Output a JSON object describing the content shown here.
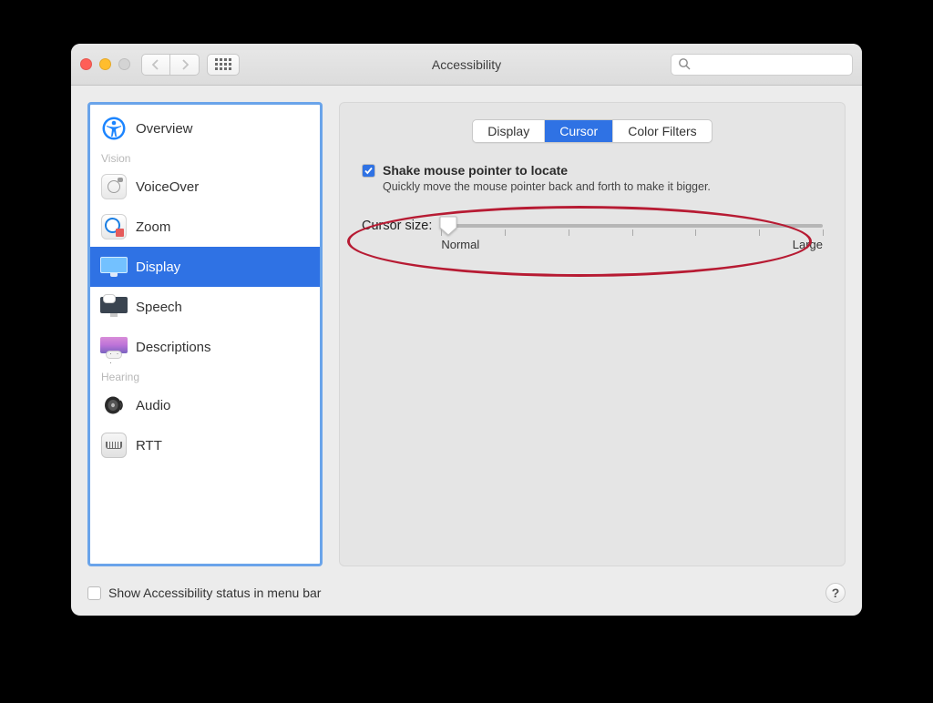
{
  "window": {
    "title": "Accessibility"
  },
  "search": {
    "placeholder": ""
  },
  "sidebar": {
    "items": [
      {
        "label": "Overview"
      },
      {
        "label": "VoiceOver"
      },
      {
        "label": "Zoom"
      },
      {
        "label": "Display"
      },
      {
        "label": "Speech"
      },
      {
        "label": "Descriptions"
      },
      {
        "label": "Audio"
      },
      {
        "label": "RTT"
      }
    ],
    "sections": {
      "vision": "Vision",
      "hearing": "Hearing"
    }
  },
  "tabs": {
    "display": "Display",
    "cursor": "Cursor",
    "color_filters": "Color Filters"
  },
  "options": {
    "shake": {
      "checked": true,
      "title": "Shake mouse pointer to locate",
      "desc": "Quickly move the mouse pointer back and forth to make it bigger."
    },
    "cursor_size": {
      "label": "Cursor size:",
      "min_label": "Normal",
      "max_label": "Large"
    }
  },
  "footer": {
    "show_status": "Show Accessibility status in menu bar",
    "help": "?"
  }
}
